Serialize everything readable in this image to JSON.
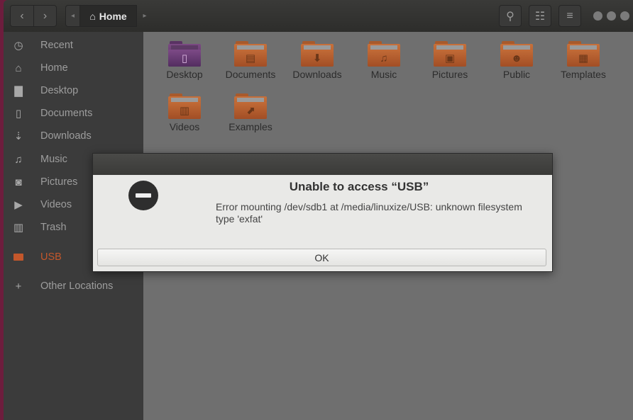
{
  "header": {
    "back_glyph": "‹",
    "forward_glyph": "›",
    "path_left_glyph": "◂",
    "path_right_glyph": "▸",
    "home_icon": "⌂",
    "location": "Home",
    "search_glyph": "⚲",
    "view_glyph": "☷",
    "menu_glyph": "≡"
  },
  "sidebar": {
    "items": [
      {
        "label": "Recent",
        "icon": "clock-icon",
        "glyph": "◷"
      },
      {
        "label": "Home",
        "icon": "home-icon",
        "glyph": "⌂"
      },
      {
        "label": "Desktop",
        "icon": "folder-icon",
        "glyph": "▇"
      },
      {
        "label": "Documents",
        "icon": "document-icon",
        "glyph": "▯"
      },
      {
        "label": "Downloads",
        "icon": "download-icon",
        "glyph": "⇣"
      },
      {
        "label": "Music",
        "icon": "music-icon",
        "glyph": "♫"
      },
      {
        "label": "Pictures",
        "icon": "camera-icon",
        "glyph": "◙"
      },
      {
        "label": "Videos",
        "icon": "video-icon",
        "glyph": "▶"
      },
      {
        "label": "Trash",
        "icon": "trash-icon",
        "glyph": "▥"
      },
      {
        "label": "USB",
        "icon": "drive-icon",
        "glyph": ""
      },
      {
        "label": "Other Locations",
        "icon": "plus-icon",
        "glyph": "+"
      }
    ]
  },
  "files": [
    {
      "label": "Desktop",
      "glyph": "▯"
    },
    {
      "label": "Documents",
      "glyph": "▤"
    },
    {
      "label": "Downloads",
      "glyph": "⬇"
    },
    {
      "label": "Music",
      "glyph": "♫"
    },
    {
      "label": "Pictures",
      "glyph": "▣"
    },
    {
      "label": "Public",
      "glyph": "☻"
    },
    {
      "label": "Templates",
      "glyph": "▦"
    },
    {
      "label": "Videos",
      "glyph": "▥"
    },
    {
      "label": "Examples",
      "glyph": "⬈"
    }
  ],
  "dialog": {
    "title": "Unable to access “USB”",
    "message": "Error mounting /dev/sdb1 at /media/linuxize/USB: unknown filesystem type 'exfat'",
    "ok_label": "OK"
  }
}
